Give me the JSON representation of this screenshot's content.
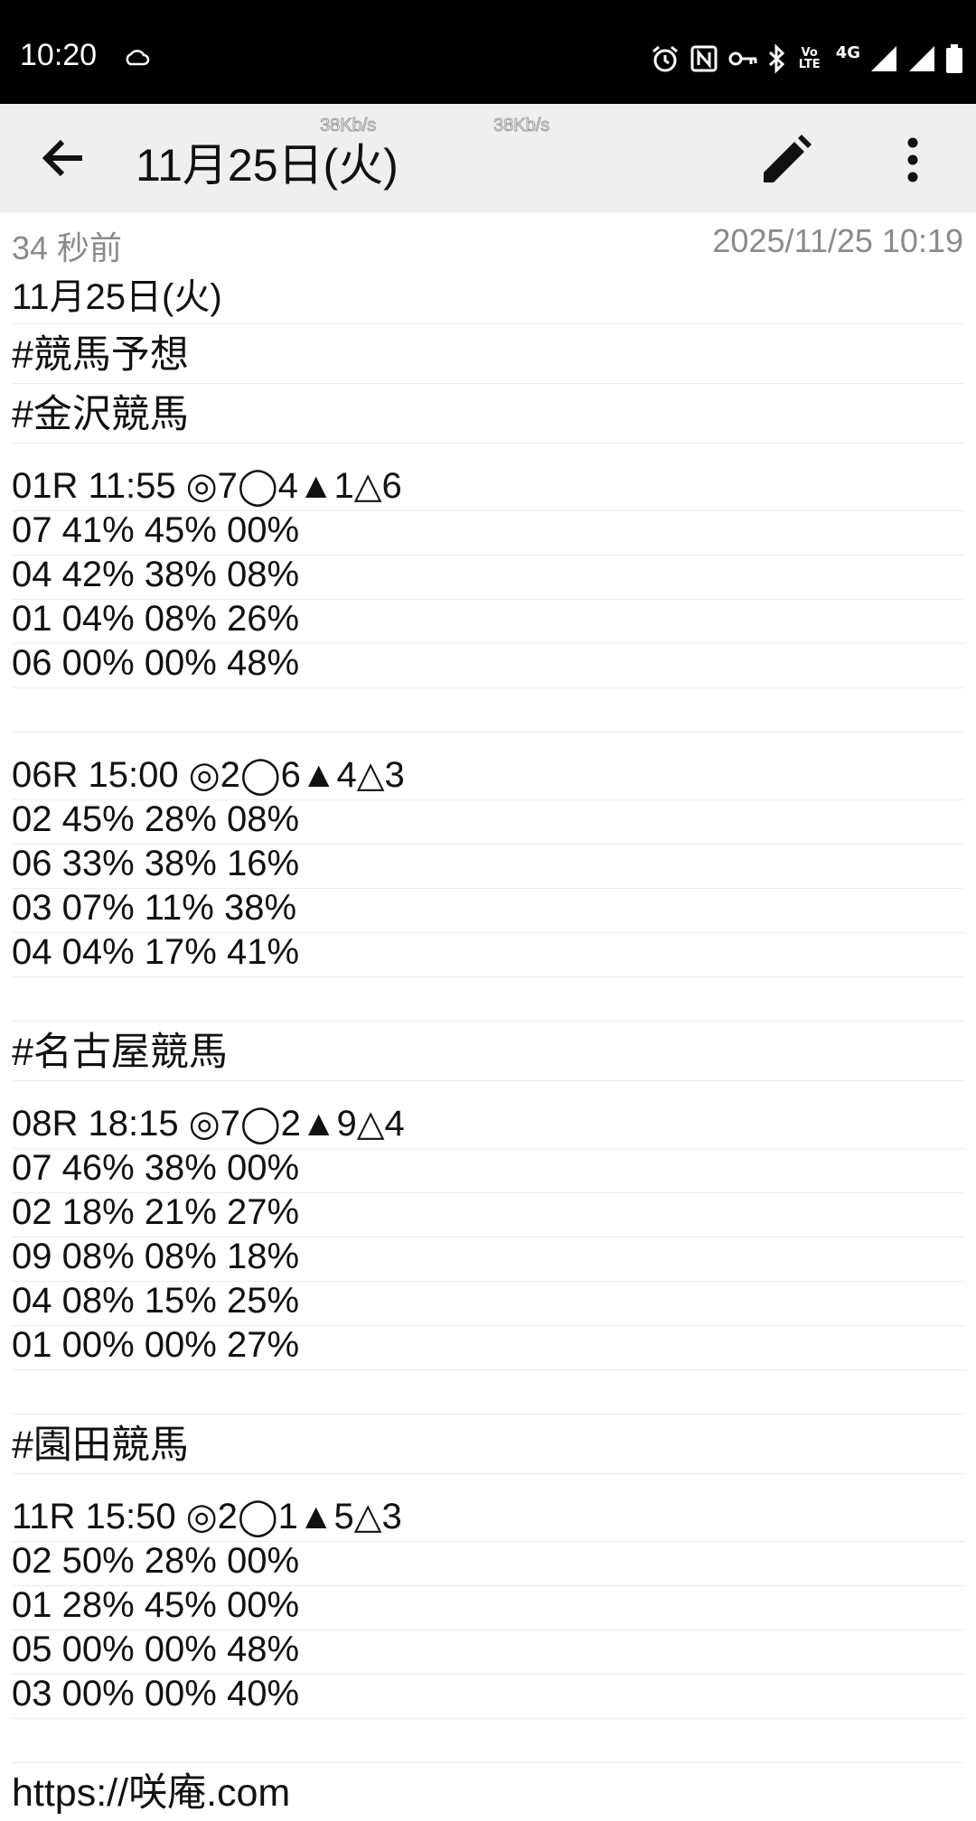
{
  "status_bar": {
    "time": "10:20",
    "icons": [
      "cloud-icon",
      "alarm-icon",
      "nfc-icon",
      "vpn-key-icon",
      "bluetooth-icon",
      "volte-icon",
      "4g-icon",
      "signal-icon",
      "signal-icon",
      "battery-icon"
    ],
    "volte_label": "Vo LTE",
    "network_label": "4G"
  },
  "app_bar": {
    "title": "11月25日(火)",
    "speed_overlay_1": "38Kb/s",
    "speed_overlay_2": "38Kb/s"
  },
  "meta": {
    "relative_time": "34 秒前",
    "timestamp": "2025/11/25 10:19"
  },
  "note": {
    "lines": [
      "11月25日(火)",
      "#競馬予想",
      "#金沢競馬",
      "01R 11:55 ◎7◯4▲1△6",
      "07 41% 45% 00%",
      "04 42% 38% 08%",
      "01 04% 08% 26%",
      "06 00% 00% 48%",
      "",
      "06R 15:00 ◎2◯6▲4△3",
      "02 45% 28% 08%",
      "06 33% 38% 16%",
      "03 07% 11% 38%",
      "04 04% 17% 41%",
      "",
      "#名古屋競馬",
      "08R 18:15 ◎7◯2▲9△4",
      "07 46% 38% 00%",
      "02 18% 21% 27%",
      "09 08% 08% 18%",
      "04 08% 15% 25%",
      "01 00% 00% 27%",
      "",
      "#園田競馬",
      "11R 15:50 ◎2◯1▲5△3",
      "02 50% 28% 00%",
      "01 28% 45% 00%",
      "05 00% 00% 48%",
      "03 00% 00% 40%",
      "",
      "https://咲庵.com"
    ]
  },
  "colors": {
    "status_bar_bg": "#000000",
    "app_bar_bg": "#efefef",
    "meta_text": "#8a8a8a",
    "rule_line": "#ececec"
  }
}
